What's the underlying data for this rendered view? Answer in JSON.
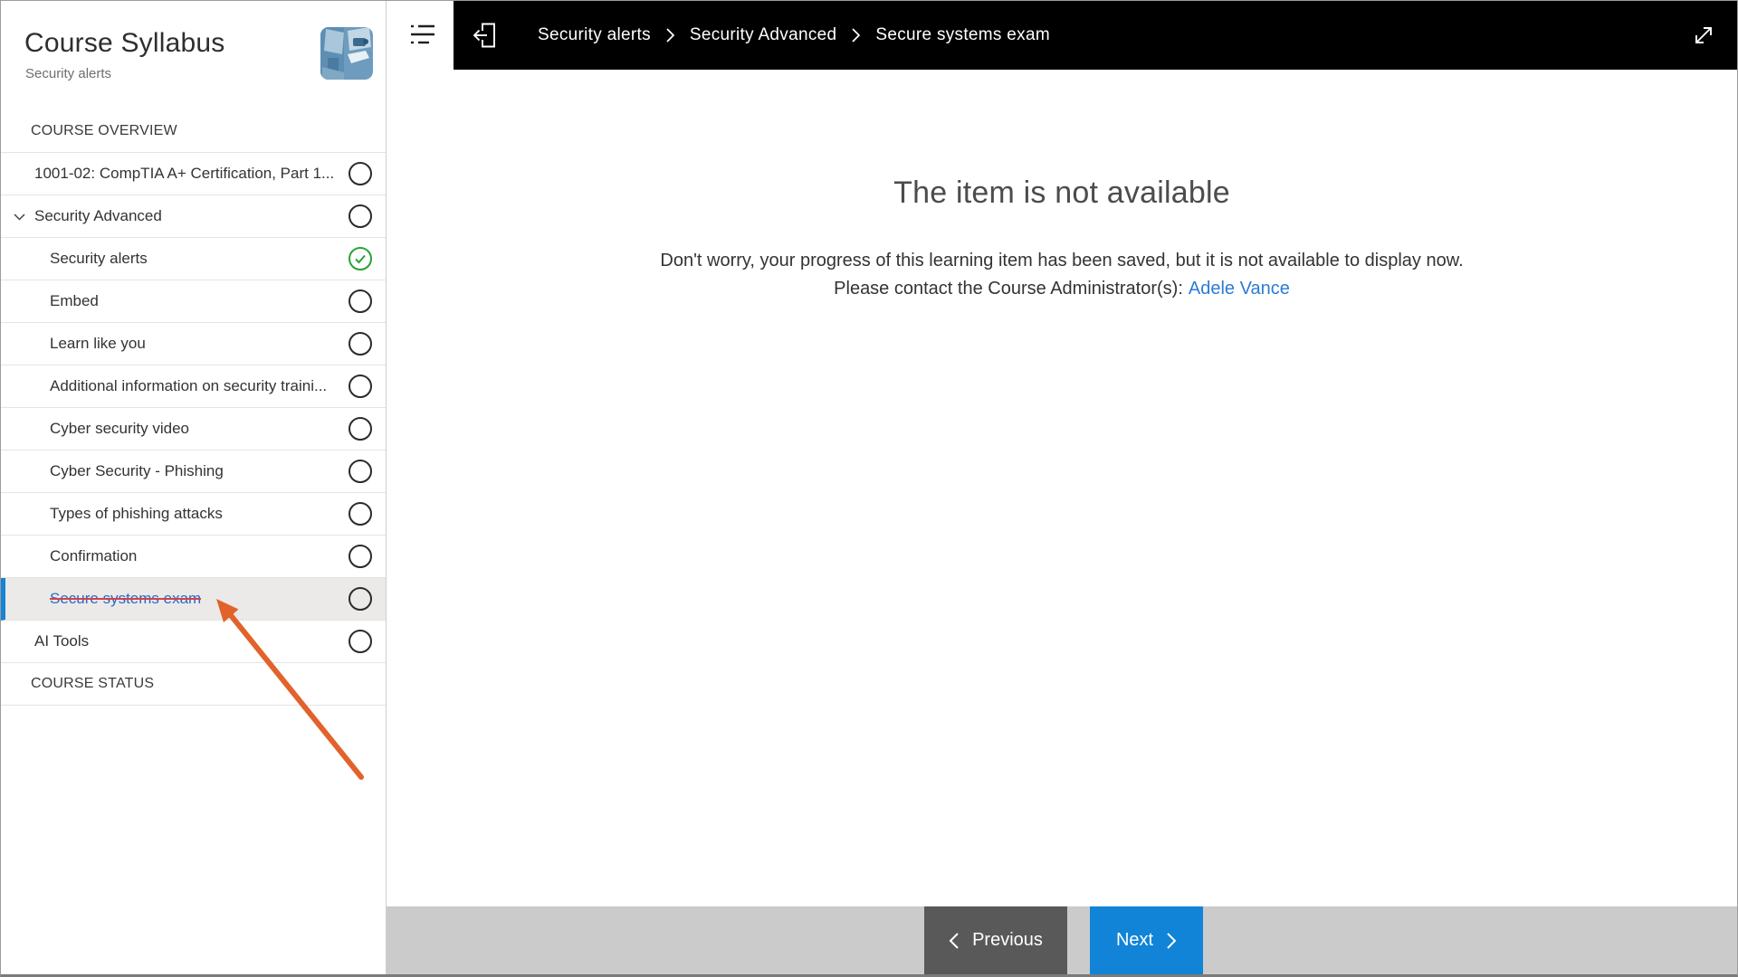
{
  "sidebar": {
    "title": "Course Syllabus",
    "subtitle": "Security alerts",
    "thumbnail": "security-cameras-thumbnail",
    "section_overview": "COURSE OVERVIEW",
    "section_status": "COURSE STATUS",
    "items": [
      {
        "type": "section",
        "label": "COURSE OVERVIEW"
      },
      {
        "type": "item",
        "level": 0,
        "label": "1001-02: CompTIA A+ Certification, Part 1...",
        "status": "not_started"
      },
      {
        "type": "item",
        "level": 0,
        "label": "Security Advanced",
        "status": "not_started",
        "expanded": true
      },
      {
        "type": "item",
        "level": 1,
        "label": "Security alerts",
        "status": "completed"
      },
      {
        "type": "item",
        "level": 1,
        "label": "Embed",
        "status": "not_started"
      },
      {
        "type": "item",
        "level": 1,
        "label": "Learn like you",
        "status": "not_started"
      },
      {
        "type": "item",
        "level": 1,
        "label": "Additional information on security traini...",
        "status": "not_started"
      },
      {
        "type": "item",
        "level": 1,
        "label": "Cyber security video",
        "status": "not_started"
      },
      {
        "type": "item",
        "level": 1,
        "label": "Cyber Security - Phishing",
        "status": "not_started"
      },
      {
        "type": "item",
        "level": 1,
        "label": "Types of phishing attacks",
        "status": "not_started"
      },
      {
        "type": "item",
        "level": 1,
        "label": "Confirmation",
        "status": "not_started"
      },
      {
        "type": "item",
        "level": 1,
        "label": "Secure systems exam",
        "status": "not_started",
        "selected": true,
        "strikethrough": true
      },
      {
        "type": "item",
        "level": 0,
        "label": "AI Tools",
        "status": "not_started"
      },
      {
        "type": "section",
        "label": "COURSE STATUS"
      }
    ]
  },
  "topbar": {
    "breadcrumbs": [
      "Security alerts",
      "Security Advanced",
      "Secure systems exam"
    ],
    "icons": [
      "syllabus-outline-icon",
      "exit-course-icon",
      "fullscreen-expand-icon"
    ]
  },
  "main": {
    "heading": "The item is not available",
    "message_line1": "Don't worry, your progress of this learning item has been saved, but it is not available to display now.",
    "message_line2_prefix": "Please contact the Course Administrator(s):",
    "admin_link": "Adele Vance"
  },
  "footer": {
    "previous_label": "Previous",
    "next_label": "Next"
  },
  "annotation": {
    "type": "arrow",
    "color": "#e2622c",
    "points_at": "Secure systems exam"
  },
  "colors": {
    "topbar_black": "#000000",
    "accent_blue": "#1184d7",
    "link_blue": "#2b7cd3",
    "selected_item_text_blue": "#2a6bc2",
    "strikethrough_red": "#ce4350",
    "completed_green": "#27a335",
    "previous_button_gray": "#595959",
    "footer_bar_gray": "#cbcbcb",
    "selected_row_bg": "#ebeae9",
    "arrow_orange": "#e2622c"
  }
}
